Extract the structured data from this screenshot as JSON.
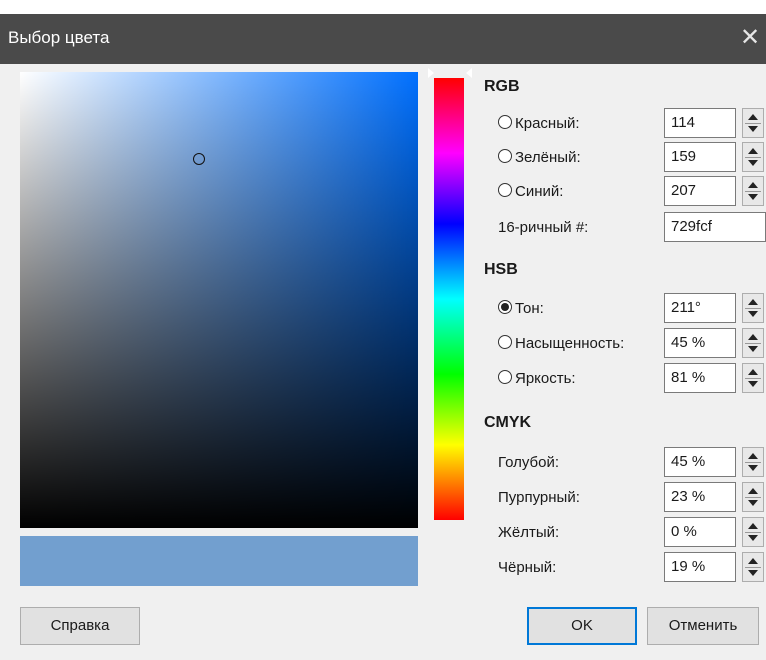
{
  "window": {
    "title": "Выбор цвета",
    "close_icon": "close-icon"
  },
  "current_color": "#729fcf",
  "field_color": "#0070ff",
  "sections": {
    "rgb": "RGB",
    "hsb": "HSB",
    "cmyk": "CMYK"
  },
  "rgb": {
    "red_label": "Красный:",
    "red_value": "114",
    "green_label": "Зелёный:",
    "green_value": "159",
    "blue_label": "Синий:",
    "blue_value": "207",
    "hex_label": "16-ричный #:",
    "hex_value": "729fcf"
  },
  "hsb": {
    "hue_label": "Тон:",
    "hue_value": "211°",
    "sat_label": "Насыщенность:",
    "sat_value": "45 %",
    "bri_label": "Яркость:",
    "bri_value": "81 %",
    "selected": "hue"
  },
  "cmyk": {
    "cyan_label": "Голубой:",
    "cyan_value": "45 %",
    "magenta_label": "Пурпурный:",
    "magenta_value": "23 %",
    "yellow_label": "Жёлтый:",
    "yellow_value": "0 %",
    "black_label": "Чёрный:",
    "black_value": "19 %"
  },
  "picker": {
    "saturation": 0.45,
    "brightness": 0.81,
    "hue_deg": 211
  },
  "buttons": {
    "help": "Справка",
    "ok": "OK",
    "cancel": "Отменить"
  }
}
